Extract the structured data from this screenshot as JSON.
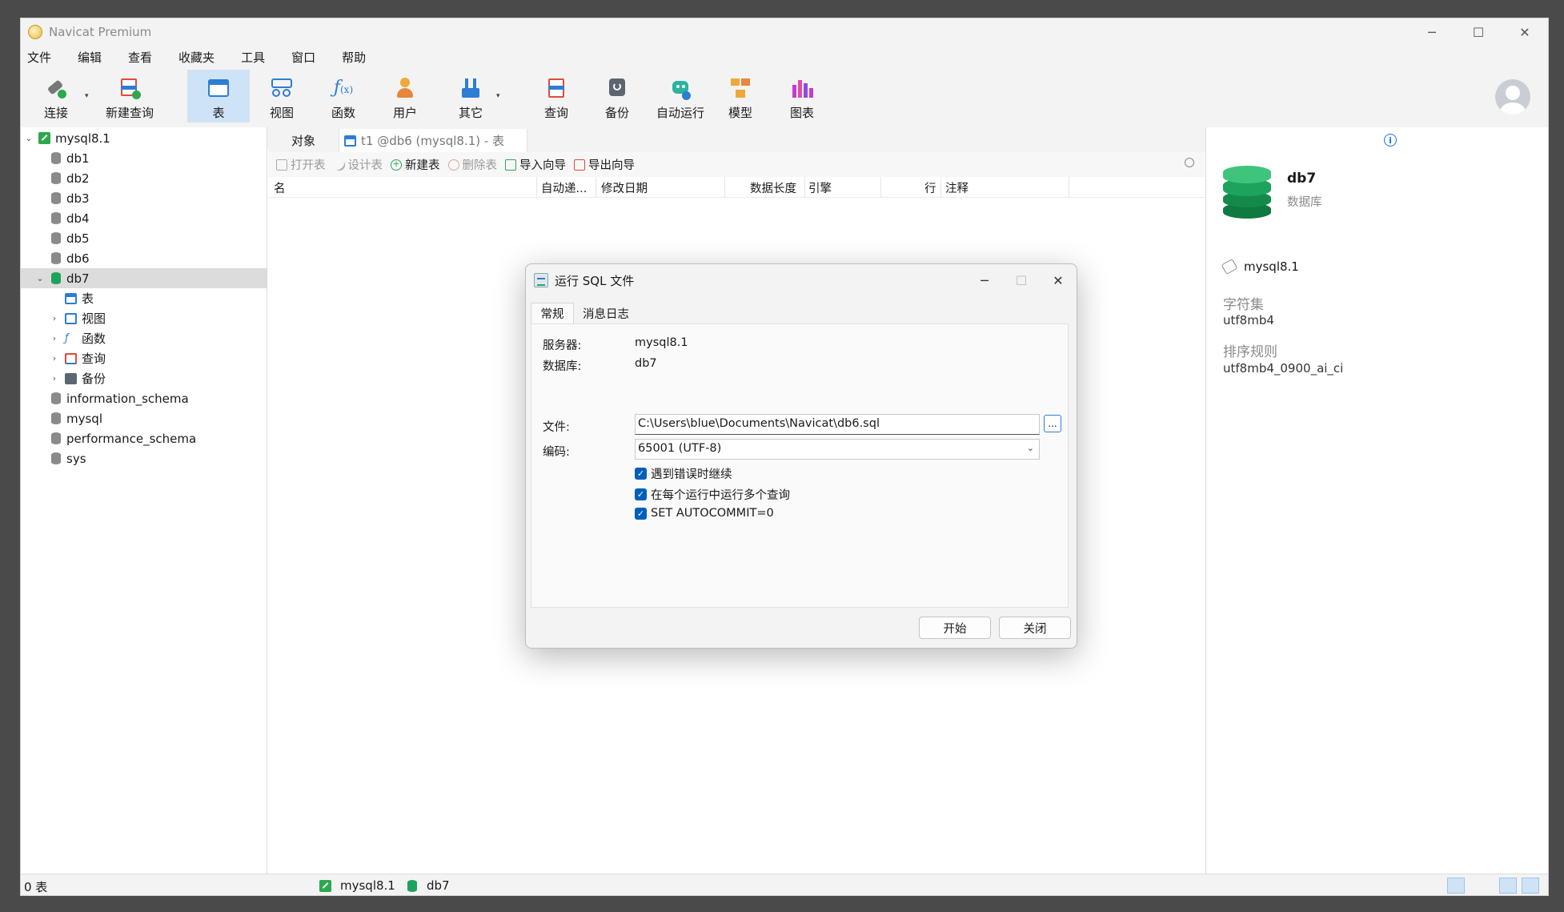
{
  "window": {
    "title": "Navicat Premium"
  },
  "menu": [
    "文件",
    "编辑",
    "查看",
    "收藏夹",
    "工具",
    "窗口",
    "帮助"
  ],
  "toolbar": {
    "buttons": [
      "连接",
      "新建查询",
      "表",
      "视图",
      "函数",
      "用户",
      "其它",
      "查询",
      "备份",
      "自动运行",
      "模型",
      "图表"
    ]
  },
  "tree": {
    "connection": "mysql8.1",
    "databases": [
      "db1",
      "db2",
      "db3",
      "db4",
      "db5",
      "db6"
    ],
    "selected_db": "db7",
    "db7_children": [
      "表",
      "视图",
      "函数",
      "查询",
      "备份"
    ],
    "other_databases": [
      "information_schema",
      "mysql",
      "performance_schema",
      "sys"
    ]
  },
  "tabs": {
    "objects": "对象",
    "t1": "t1 @db6 (mysql8.1) - 表"
  },
  "object_toolbar": [
    "打开表",
    "设计表",
    "新建表",
    "删除表",
    "导入向导",
    "导出向导"
  ],
  "grid_columns": [
    "名",
    "自动递...",
    "修改日期",
    "数据长度",
    "引擎",
    "行",
    "注释"
  ],
  "right_panel": {
    "name": "db7",
    "type": "数据库",
    "connection": "mysql8.1",
    "charset_label": "字符集",
    "charset": "utf8mb4",
    "collation_label": "排序规则",
    "collation": "utf8mb4_0900_ai_ci"
  },
  "status": {
    "count": "0 表",
    "connection": "mysql8.1",
    "database": "db7"
  },
  "dialog": {
    "title": "运行 SQL 文件",
    "tab_general": "常规",
    "tab_log": "消息日志",
    "server_label": "服务器:",
    "server": "mysql8.1",
    "db_label": "数据库:",
    "db": "db7",
    "file_label": "文件:",
    "file": "C:\\Users\\blue\\Documents\\Navicat\\db6.sql",
    "browse": "...",
    "encoding_label": "编码:",
    "encoding": "65001 (UTF-8)",
    "opt1": "遇到错误时继续",
    "opt2": "在每个运行中运行多个查询",
    "opt3": "SET AUTOCOMMIT=0",
    "start": "开始",
    "close": "关闭"
  },
  "colors": {
    "accent": "#005fb8",
    "toolbar_active": "#cfe3f7",
    "db_green": "#1ea35c"
  }
}
